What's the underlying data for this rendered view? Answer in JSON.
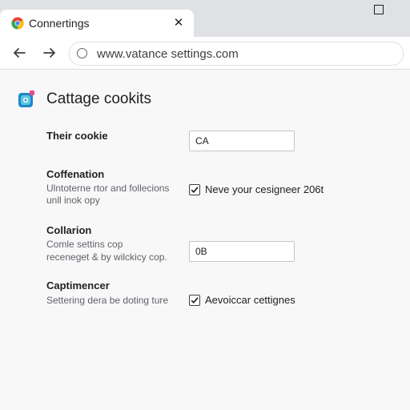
{
  "tab": {
    "title": "Connertings",
    "close_glyph": "✕",
    "favicon": "chrome-icon"
  },
  "window": {
    "maximize_icon": "maximize-icon"
  },
  "toolbar": {
    "url": "www.vatance settings.com",
    "back_icon": "back-arrow-icon",
    "forward_icon": "forward-arrow-icon",
    "site_info_icon": "site-info-icon"
  },
  "page": {
    "title": "Cattage cookits",
    "icon": "settings-app-icon",
    "accent_color": "#1a73e8",
    "sections": [
      {
        "title": "Their cookie",
        "control": "input",
        "value": "CA"
      },
      {
        "title": "Coffenation",
        "desc_lines": [
          "Ulntoterne rtor and follecions",
          "unll inok opy"
        ],
        "control": "checkbox",
        "checked": true,
        "label": "Neve your cesigneer 206t"
      },
      {
        "title": "Collarion",
        "desc_lines": [
          "Comle settins cop",
          "receneget & by wilckicy cop."
        ],
        "control": "input",
        "value": "0B"
      },
      {
        "title": "Captimencer",
        "desc_lines": [
          "Settering dera be doting ture"
        ],
        "control": "checkbox",
        "checked": true,
        "label": "Aevoiccar cettignes"
      }
    ]
  }
}
